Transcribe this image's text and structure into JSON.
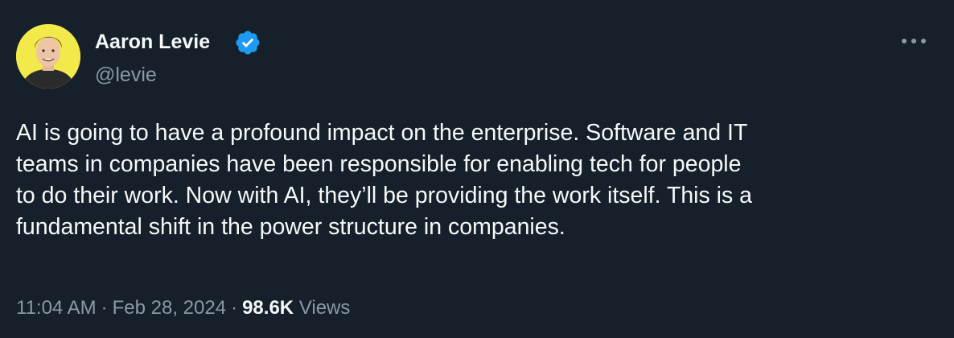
{
  "author": {
    "name": "Aaron Levie",
    "handle": "@levie",
    "verified_icon": "verified-badge-icon",
    "avatar_bg": "#f4e94a"
  },
  "tweet": {
    "text": "AI is going to have a profound impact on the enterprise. Software and IT\nteams in companies have been responsible for enabling tech for people\nto do their work. Now with AI, they’ll be providing the work itself. This is a\nfundamental shift in the power structure in companies."
  },
  "meta": {
    "time": "11:04 AM",
    "separator": "·",
    "date": "Feb 28, 2024",
    "views_count": "98.6K",
    "views_label": "Views"
  },
  "colors": {
    "background": "#15202b",
    "text": "#f7f9f9",
    "secondary": "#8b98a5",
    "verified": "#1d9bf0"
  }
}
